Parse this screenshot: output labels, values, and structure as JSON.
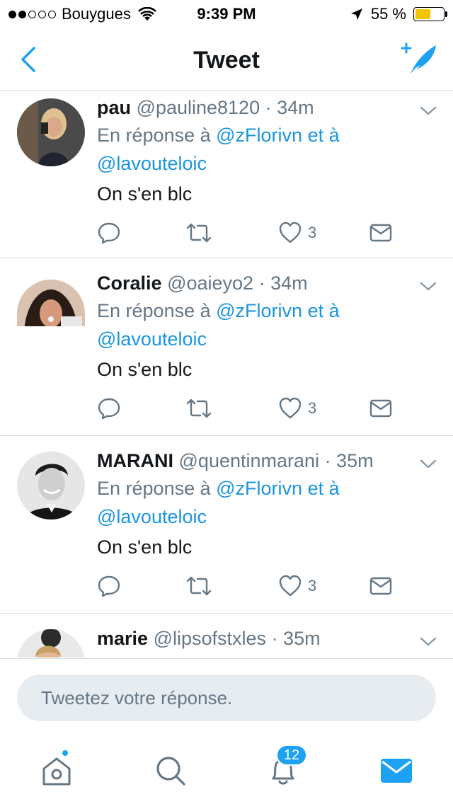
{
  "status_bar": {
    "carrier": "Bouygues",
    "time": "9:39 PM",
    "battery_percent": "55 %",
    "battery_level": 0.55,
    "battery_color": "#f5c400"
  },
  "nav": {
    "title": "Tweet",
    "back_icon": "chevron-left-icon",
    "compose_icon": "compose-tweet-icon",
    "accent": "#1da1f2"
  },
  "tweets": [
    {
      "name": "pau",
      "handle": "@pauline8120",
      "time": "· 34m",
      "reply_prefix": "En réponse à",
      "reply_to_1": "@zFlorivn",
      "reply_joiner": "et à",
      "reply_to_2": "@lavouteloic",
      "text": "On s'en blc",
      "likes": "3"
    },
    {
      "name": "Coralie",
      "handle": "@oaieyo2",
      "time": "· 34m",
      "reply_prefix": "En réponse à",
      "reply_to_1": "@zFlorivn",
      "reply_joiner": "et à",
      "reply_to_2": "@lavouteloic",
      "text": "On s'en blc",
      "likes": "3"
    },
    {
      "name": "MARANI",
      "handle": "@quentinmarani",
      "time": "· 35m",
      "reply_prefix": "En réponse à",
      "reply_to_1": "@zFlorivn",
      "reply_joiner": "et à",
      "reply_to_2": "@lavouteloic",
      "text": "On s'en blc",
      "likes": "3"
    },
    {
      "name": "marie",
      "handle": "@lipsofstxles",
      "time": "· 35m"
    }
  ],
  "reply_box": {
    "placeholder": "Tweetez votre réponse."
  },
  "tabbar": {
    "notifications_count": "12",
    "items": [
      "home-icon",
      "search-icon",
      "notifications-icon",
      "messages-icon"
    ]
  }
}
